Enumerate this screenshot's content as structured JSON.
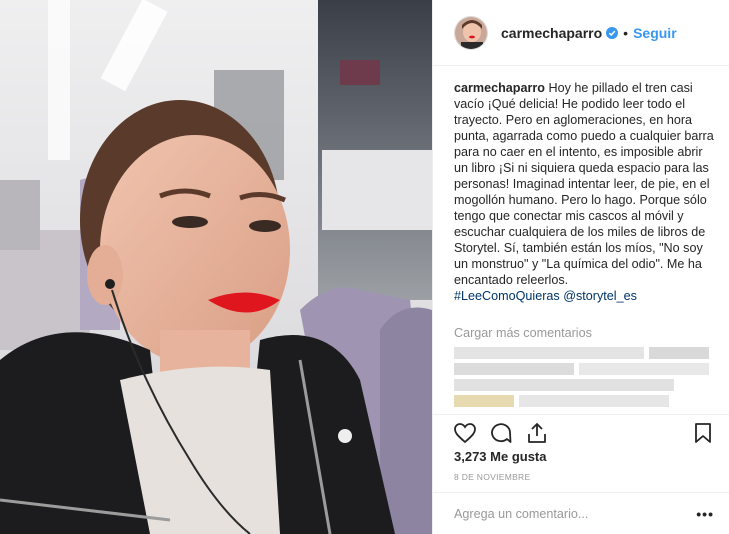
{
  "post": {
    "username": "carmechaparro",
    "separator": "•",
    "follow_label": "Seguir",
    "caption_user": "carmechaparro",
    "caption_text": "Hoy he pillado el tren casi vacío ¡Qué delicia! He podido leer todo el trayecto. Pero en aglomeraciones, en hora punta, agarrada como puedo a cualquier barra para no caer en el intento, es imposible abrir un libro ¡Si ni siquiera queda espacio para las personas! Imaginad intentar leer, de pie, en el mogollón humano. Pero lo hago. Porque sólo tengo que conectar mis cascos al móvil y escuchar cualquiera de los miles de libros de Storytel. Sí, también están los míos, \"No soy un monstruo\" y \"La química del odio\". Me ha encantado releerlos.",
    "caption_tags": "#LeeComoQuieras @storytel_es",
    "load_more": "Cargar más comentarios",
    "likes": "3,273 Me gusta",
    "date": "8 DE NOVIEMBRE",
    "comment_placeholder": "Agrega un comentario...",
    "more_options": "•••"
  },
  "icons": {
    "verified": "verified-badge-icon",
    "like": "heart-icon",
    "comment": "comment-bubble-icon",
    "share": "share-icon",
    "save": "bookmark-icon"
  },
  "colors": {
    "link": "#3897f0",
    "verified": "#3897f0",
    "hashtag": "#003569",
    "muted": "#999999",
    "text": "#262626",
    "divider": "#efefef"
  }
}
